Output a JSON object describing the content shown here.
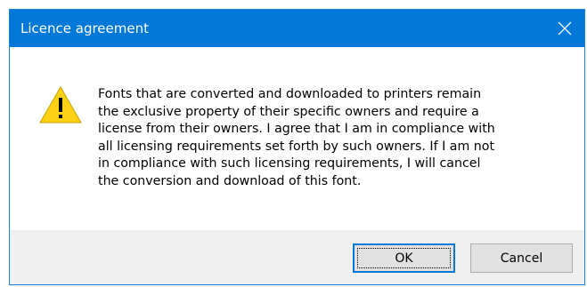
{
  "window": {
    "title": "Licence agreement",
    "close_icon": "close-icon",
    "title_bar_color": "#0078d7"
  },
  "content": {
    "icon": "warning-icon",
    "message": "Fonts that are converted and downloaded to printers remain\nthe exclusive property of their specific owners and require a\nlicense from their owners. I agree that I am in compliance with\nall licensing requirements set forth by such owners. If I am not\nin compliance with such licensing requirements, I will cancel\nthe conversion and download of this font."
  },
  "buttons": {
    "ok_label": "OK",
    "cancel_label": "Cancel"
  }
}
